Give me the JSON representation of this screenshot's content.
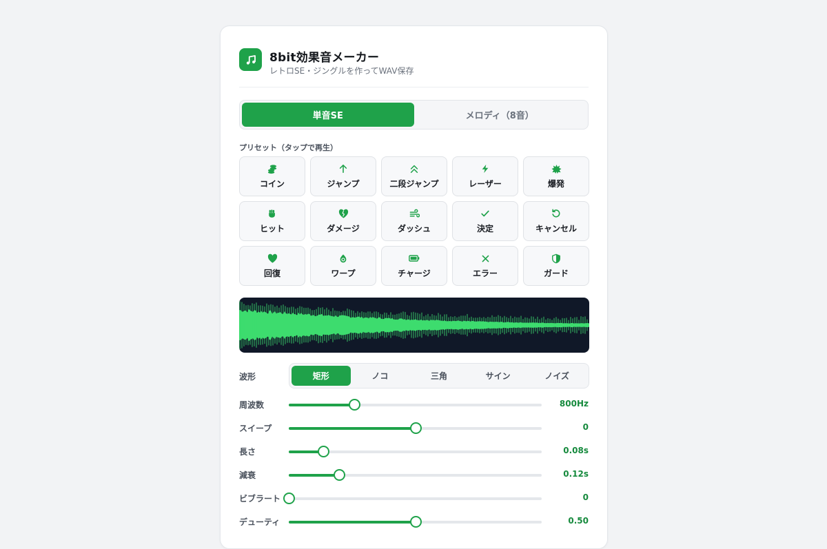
{
  "app": {
    "title": "8bit効果音メーカー",
    "subtitle": "レトロSE・ジングルを作ってWAV保存",
    "icon": "music-note-icon",
    "accent": "#1fa24a"
  },
  "mode_tabs": [
    {
      "label": "単音SE",
      "active": true
    },
    {
      "label": "メロディ（8音）",
      "active": false
    }
  ],
  "presets_label": "プリセット（タップで再生）",
  "presets": [
    {
      "label": "コイン",
      "icon": "coins-icon"
    },
    {
      "label": "ジャンプ",
      "icon": "arrow-up-icon"
    },
    {
      "label": "二段ジャンプ",
      "icon": "double-chevron-up-icon"
    },
    {
      "label": "レーザー",
      "icon": "bolt-icon"
    },
    {
      "label": "爆発",
      "icon": "burst-icon"
    },
    {
      "label": "ヒット",
      "icon": "fist-icon"
    },
    {
      "label": "ダメージ",
      "icon": "broken-heart-icon"
    },
    {
      "label": "ダッシュ",
      "icon": "wind-icon"
    },
    {
      "label": "決定",
      "icon": "check-icon"
    },
    {
      "label": "キャンセル",
      "icon": "undo-icon"
    },
    {
      "label": "回復",
      "icon": "heart-icon"
    },
    {
      "label": "ワープ",
      "icon": "warp-icon"
    },
    {
      "label": "チャージ",
      "icon": "battery-icon"
    },
    {
      "label": "エラー",
      "icon": "x-icon"
    },
    {
      "label": "ガード",
      "icon": "shield-icon"
    }
  ],
  "waveform": {
    "label": "波形",
    "options": [
      "矩形",
      "ノコ",
      "三角",
      "サイン",
      "ノイズ"
    ],
    "selected": "矩形",
    "display_color": "#3ddc6e",
    "display_bg": "#101828"
  },
  "sliders": [
    {
      "label": "周波数",
      "value_text": "800Hz",
      "fraction": 0.26
    },
    {
      "label": "スイープ",
      "value_text": "0",
      "fraction": 0.5
    },
    {
      "label": "長さ",
      "value_text": "0.08s",
      "fraction": 0.135
    },
    {
      "label": "減衰",
      "value_text": "0.12s",
      "fraction": 0.2
    },
    {
      "label": "ビブラート",
      "value_text": "0",
      "fraction": 0.0
    },
    {
      "label": "デューティ",
      "value_text": "0.50",
      "fraction": 0.5
    }
  ]
}
